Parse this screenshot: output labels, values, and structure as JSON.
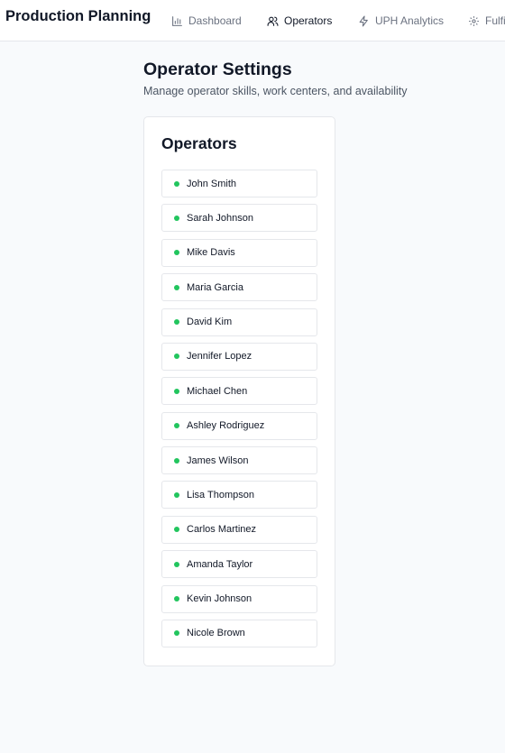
{
  "app": {
    "title": "Production Planning"
  },
  "nav": {
    "tabs": [
      {
        "label": "Dashboard",
        "icon": "bar-chart-icon",
        "active": false
      },
      {
        "label": "Operators",
        "icon": "users-icon",
        "active": true
      },
      {
        "label": "UPH Analytics",
        "icon": "lightning-icon",
        "active": false
      },
      {
        "label": "Fulfillment",
        "icon": "gear-icon",
        "active": false
      }
    ]
  },
  "page": {
    "title": "Operator Settings",
    "subtitle": "Manage operator skills, work centers, and availability"
  },
  "operators_card": {
    "title": "Operators",
    "status_color": "#22c55e",
    "items": [
      {
        "name": "John Smith"
      },
      {
        "name": "Sarah Johnson"
      },
      {
        "name": "Mike Davis"
      },
      {
        "name": "Maria Garcia"
      },
      {
        "name": "David Kim"
      },
      {
        "name": "Jennifer Lopez"
      },
      {
        "name": "Michael Chen"
      },
      {
        "name": "Ashley Rodriguez"
      },
      {
        "name": "James Wilson"
      },
      {
        "name": "Lisa Thompson"
      },
      {
        "name": "Carlos Martinez"
      },
      {
        "name": "Amanda Taylor"
      },
      {
        "name": "Kevin Johnson"
      },
      {
        "name": "Nicole Brown"
      }
    ]
  },
  "colors": {
    "accent": "#3b82f6",
    "background": "#f8fafc"
  }
}
